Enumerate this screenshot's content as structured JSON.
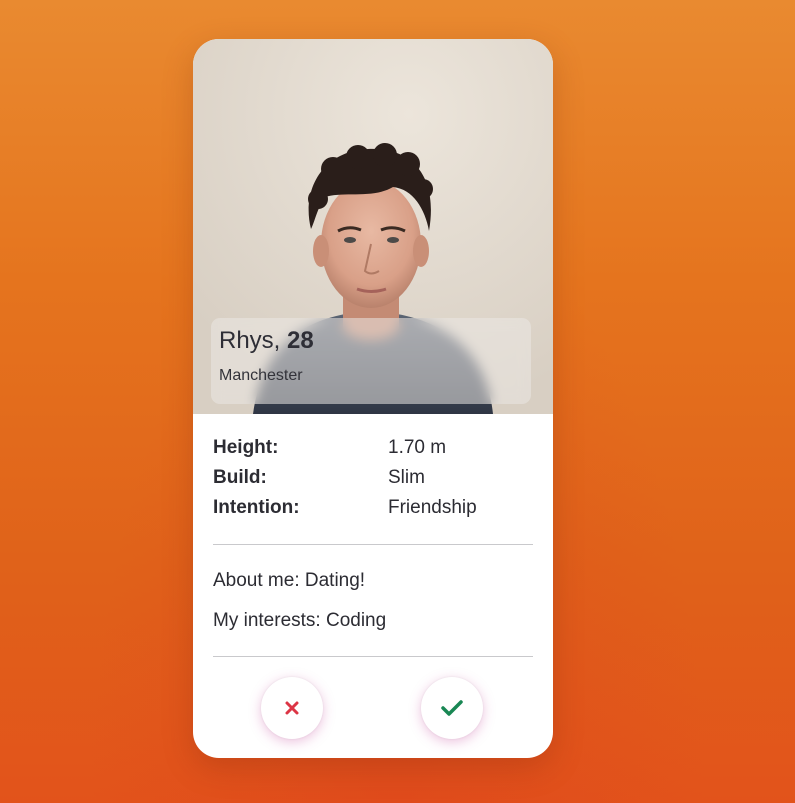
{
  "profile": {
    "name": "Rhys, ",
    "age": "28",
    "location": "Manchester"
  },
  "details": [
    {
      "label": "Height:",
      "value": "1.70 m"
    },
    {
      "label": "Build:",
      "value": "Slim"
    },
    {
      "label": "Intention:",
      "value": "Friendship"
    }
  ],
  "about": {
    "about_me": "About me: Dating!",
    "interests": "My interests: Coding"
  },
  "actions": {
    "reject_icon": "close-icon",
    "accept_icon": "check-icon"
  },
  "colors": {
    "reject": "#dc3545",
    "accept": "#198754",
    "background": "#e5741e"
  }
}
